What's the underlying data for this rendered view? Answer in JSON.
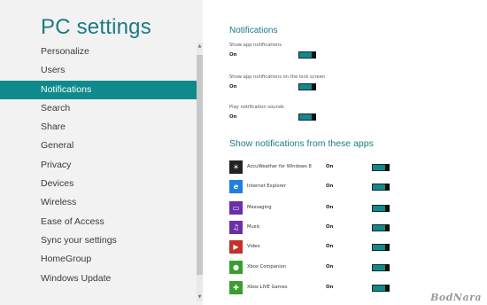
{
  "left_panel": {
    "title": "PC settings",
    "items": [
      {
        "label": "Personalize"
      },
      {
        "label": "Users"
      },
      {
        "label": "Notifications",
        "selected": true
      },
      {
        "label": "Search"
      },
      {
        "label": "Share"
      },
      {
        "label": "General"
      },
      {
        "label": "Privacy"
      },
      {
        "label": "Devices"
      },
      {
        "label": "Wireless"
      },
      {
        "label": "Ease of Access"
      },
      {
        "label": "Sync your settings"
      },
      {
        "label": "HomeGroup"
      },
      {
        "label": "Windows Update"
      }
    ]
  },
  "notifications": {
    "heading": "Notifications",
    "settings": [
      {
        "label": "Show app notifications",
        "value": "On"
      },
      {
        "label": "Show app notifications on the lock screen",
        "value": "On"
      },
      {
        "label": "Play notification sounds",
        "value": "On"
      }
    ]
  },
  "apps": {
    "heading": "Show notifications from these apps",
    "items": [
      {
        "name": "AccuWeather for Windows 8",
        "value": "On",
        "icon": "sun-icon",
        "color": "#222222"
      },
      {
        "name": "Internet Explorer",
        "value": "On",
        "icon": "internet-explorer-icon",
        "color": "#1e7fe0"
      },
      {
        "name": "Messaging",
        "value": "On",
        "icon": "messaging-icon",
        "color": "#6b2fa8"
      },
      {
        "name": "Music",
        "value": "On",
        "icon": "headphones-icon",
        "color": "#6b2fa8"
      },
      {
        "name": "Video",
        "value": "On",
        "icon": "video-icon",
        "color": "#c4302b"
      },
      {
        "name": "Xbox Companion",
        "value": "On",
        "icon": "xbox-icon",
        "color": "#3a9e2e"
      },
      {
        "name": "Xbox LIVE Games",
        "value": "On",
        "icon": "controller-icon",
        "color": "#3a9e2e"
      }
    ]
  },
  "colors": {
    "accent": "#0e8a8d",
    "title_teal": "#1a7b84"
  },
  "watermark": "BodNara"
}
